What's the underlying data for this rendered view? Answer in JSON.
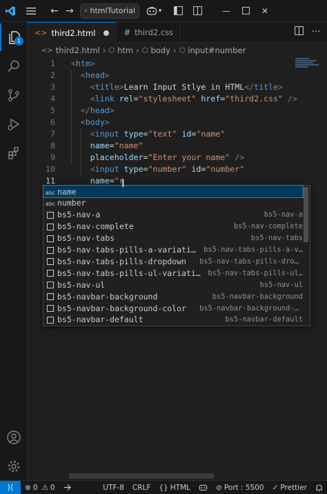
{
  "titlebar": {
    "search_label": "htmlTutorial"
  },
  "tabs": [
    {
      "label": "third2.html",
      "modified": true,
      "active": true
    },
    {
      "label": "third2.css",
      "modified": false,
      "active": false
    }
  ],
  "breadcrumb": {
    "file": "third2.html",
    "items": [
      "htm",
      "body",
      "input#number"
    ]
  },
  "activity": {
    "explorer_badge": "1"
  },
  "editor": {
    "current_line": 11,
    "line_numbers": [
      "1",
      "2",
      "3",
      "4",
      "5",
      "6",
      "7",
      "8",
      "9",
      "10",
      "11"
    ],
    "lines": [
      [
        {
          "c": "brk",
          "t": "<"
        },
        {
          "c": "tag",
          "t": "htm"
        },
        {
          "c": "brk",
          "t": ">"
        }
      ],
      [
        {
          "c": "brk",
          "t": "<"
        },
        {
          "c": "tag",
          "t": "head"
        },
        {
          "c": "brk",
          "t": ">"
        }
      ],
      [
        {
          "c": "brk",
          "t": "<"
        },
        {
          "c": "tag",
          "t": "title"
        },
        {
          "c": "brk",
          "t": ">"
        },
        {
          "c": "txt",
          "t": "Learn Input Stlye in HTML"
        },
        {
          "c": "brk",
          "t": "</"
        },
        {
          "c": "tag",
          "t": "title"
        },
        {
          "c": "brk",
          "t": ">"
        }
      ],
      [
        {
          "c": "brk",
          "t": "<"
        },
        {
          "c": "tag",
          "t": "link"
        },
        {
          "c": "txt",
          "t": " "
        },
        {
          "c": "attr",
          "t": "rel"
        },
        {
          "c": "txt",
          "t": "="
        },
        {
          "c": "str",
          "t": "\"stylesheet\""
        },
        {
          "c": "txt",
          "t": " "
        },
        {
          "c": "attr",
          "t": "href"
        },
        {
          "c": "txt",
          "t": "="
        },
        {
          "c": "str",
          "t": "\"third2.css\""
        },
        {
          "c": "txt",
          "t": " "
        },
        {
          "c": "brk",
          "t": "/>"
        }
      ],
      [
        {
          "c": "brk",
          "t": "</"
        },
        {
          "c": "tag",
          "t": "head"
        },
        {
          "c": "brk",
          "t": ">"
        }
      ],
      [
        {
          "c": "brk",
          "t": "<"
        },
        {
          "c": "tag",
          "t": "body"
        },
        {
          "c": "brk",
          "t": ">"
        }
      ],
      [
        {
          "c": "brk",
          "t": "<"
        },
        {
          "c": "tag",
          "t": "input"
        },
        {
          "c": "txt",
          "t": " "
        },
        {
          "c": "attr",
          "t": "type"
        },
        {
          "c": "txt",
          "t": "="
        },
        {
          "c": "str",
          "t": "\"text\""
        },
        {
          "c": "txt",
          "t": " "
        },
        {
          "c": "attr",
          "t": "id"
        },
        {
          "c": "txt",
          "t": "="
        },
        {
          "c": "str",
          "t": "\"name\""
        }
      ],
      [
        {
          "c": "attr",
          "t": "name"
        },
        {
          "c": "txt",
          "t": "="
        },
        {
          "c": "str",
          "t": "\"name\""
        }
      ],
      [
        {
          "c": "attr",
          "t": "placeholder"
        },
        {
          "c": "txt",
          "t": "="
        },
        {
          "c": "str",
          "t": "\"Enter your name\""
        },
        {
          "c": "txt",
          "t": " "
        },
        {
          "c": "brk",
          "t": "/>"
        }
      ],
      [
        {
          "c": "brk",
          "t": "<"
        },
        {
          "c": "tag",
          "t": "input"
        },
        {
          "c": "txt",
          "t": " "
        },
        {
          "c": "attr",
          "t": "type"
        },
        {
          "c": "txt",
          "t": "="
        },
        {
          "c": "str",
          "t": "\"number\""
        },
        {
          "c": "txt",
          "t": " "
        },
        {
          "c": "attr",
          "t": "id"
        },
        {
          "c": "txt",
          "t": "="
        },
        {
          "c": "str",
          "t": "\"number\""
        }
      ],
      [
        {
          "c": "attr",
          "t": "name"
        },
        {
          "c": "txt",
          "t": "="
        },
        {
          "c": "str",
          "t": "\"r"
        }
      ]
    ]
  },
  "suggestions": [
    {
      "kind": "abc",
      "label": "name",
      "detail": "",
      "selected": true
    },
    {
      "kind": "abc",
      "label": "number",
      "detail": "",
      "selected": false
    },
    {
      "kind": "snippet",
      "label": "bs5-nav-a",
      "detail": "bs5-nav-a",
      "selected": false
    },
    {
      "kind": "snippet",
      "label": "bs5-nav-complete",
      "detail": "bs5-nav-complete",
      "selected": false
    },
    {
      "kind": "snippet",
      "label": "bs5-nav-tabs",
      "detail": "bs5-nav-tabs",
      "selected": false
    },
    {
      "kind": "snippet",
      "label": "bs5-nav-tabs-pills-a-variati…",
      "detail": "bs5-nav-tabs-pills-a-v…",
      "selected": false
    },
    {
      "kind": "snippet",
      "label": "bs5-nav-tabs-pills-dropdown",
      "detail": "bs5-nav-tabs-pills-dropd…",
      "selected": false
    },
    {
      "kind": "snippet",
      "label": "bs5-nav-tabs-pills-ul-variati…",
      "detail": "bs5-nav-tabs-pills-ul…",
      "selected": false
    },
    {
      "kind": "snippet",
      "label": "bs5-nav-ul",
      "detail": "bs5-nav-ul",
      "selected": false
    },
    {
      "kind": "snippet",
      "label": "bs5-navbar-background",
      "detail": "bs5-navbar-background",
      "selected": false
    },
    {
      "kind": "snippet",
      "label": "bs5-navbar-background-color",
      "detail": "bs5-navbar-background-co…",
      "selected": false
    },
    {
      "kind": "snippet",
      "label": "bs5-navbar-default",
      "detail": "bs5-navbar-default",
      "selected": false
    }
  ],
  "statusbar": {
    "errors": "0",
    "warnings": "0",
    "encoding": "UTF-8",
    "eol": "CRLF",
    "language": "HTML",
    "port": "Port : 5500",
    "prettier": "Prettier"
  },
  "colors": {
    "accent": "#0078d4",
    "selection": "#04395e",
    "match_highlight": "#2aaaff"
  }
}
